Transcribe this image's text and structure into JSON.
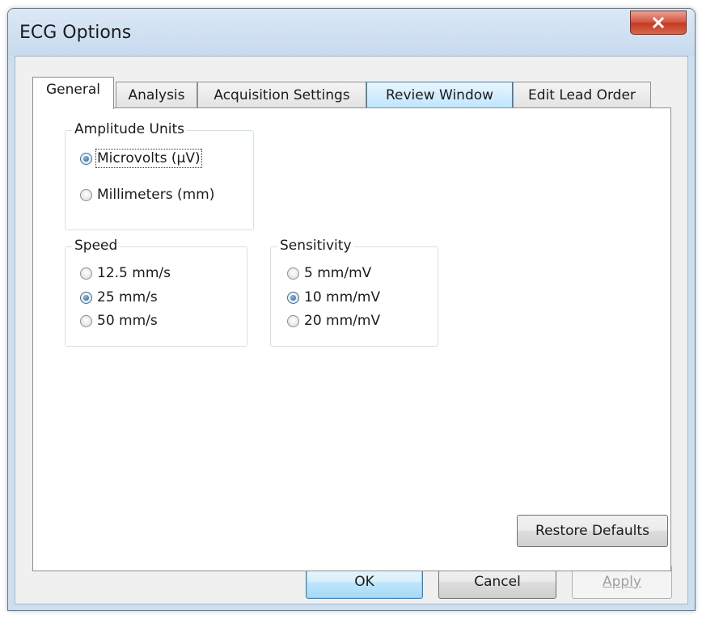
{
  "window": {
    "title": "ECG Options",
    "close_icon": "close-icon"
  },
  "tabs": [
    {
      "label": "General",
      "active": true
    },
    {
      "label": "Analysis",
      "active": false
    },
    {
      "label": "Acquisition Settings",
      "active": false
    },
    {
      "label": "Review Window",
      "active": false,
      "hover": true
    },
    {
      "label": "Edit Lead Order",
      "active": false
    }
  ],
  "general": {
    "amplitude_units": {
      "caption": "Amplitude Units",
      "options": [
        {
          "label": "Microvolts (µV)",
          "checked": true
        },
        {
          "label": "Millimeters (mm)",
          "checked": false
        }
      ]
    },
    "speed": {
      "caption": "Speed",
      "options": [
        {
          "label": "12.5 mm/s",
          "checked": false
        },
        {
          "label": "25 mm/s",
          "checked": true
        },
        {
          "label": "50 mm/s",
          "checked": false
        }
      ]
    },
    "sensitivity": {
      "caption": "Sensitivity",
      "options": [
        {
          "label": "5 mm/mV",
          "checked": false
        },
        {
          "label": "10 mm/mV",
          "checked": true
        },
        {
          "label": "20 mm/mV",
          "checked": false
        }
      ]
    },
    "restore_defaults_label": "Restore Defaults"
  },
  "footer": {
    "ok_label": "OK",
    "cancel_label": "Cancel",
    "apply_label": "Apply"
  }
}
